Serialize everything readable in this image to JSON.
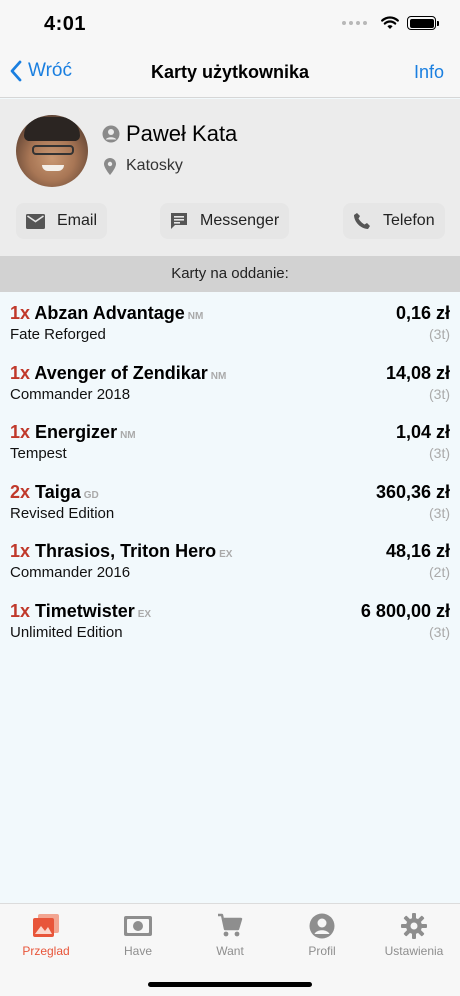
{
  "status": {
    "time": "4:01"
  },
  "nav": {
    "back_label": "Wróć",
    "title": "Karty użytkownika",
    "info_label": "Info"
  },
  "profile": {
    "name": "Paweł Kata",
    "location": "Katosky"
  },
  "contacts": {
    "email": "Email",
    "messenger": "Messenger",
    "phone": "Telefon"
  },
  "section": {
    "title": "Karty na oddanie:"
  },
  "cards": [
    {
      "qty": "1x",
      "name": "Abzan Advantage",
      "condition": "NM",
      "set": "Fate Reforged",
      "price": "0,16 zł",
      "count": "(3t)"
    },
    {
      "qty": "1x",
      "name": "Avenger of Zendikar",
      "condition": "NM",
      "set": "Commander 2018",
      "price": "14,08 zł",
      "count": "(3t)"
    },
    {
      "qty": "1x",
      "name": "Energizer",
      "condition": "NM",
      "set": "Tempest",
      "price": "1,04 zł",
      "count": "(3t)"
    },
    {
      "qty": "2x",
      "name": "Taiga",
      "condition": "GD",
      "set": "Revised Edition",
      "price": "360,36 zł",
      "count": "(3t)"
    },
    {
      "qty": "1x",
      "name": "Thrasios, Triton Hero",
      "condition": "EX",
      "set": "Commander 2016",
      "price": "48,16 zł",
      "count": "(2t)"
    },
    {
      "qty": "1x",
      "name": "Timetwister",
      "condition": "EX",
      "set": "Unlimited Edition",
      "price": "6 800,00 zł",
      "count": "(3t)"
    }
  ],
  "tabs": [
    {
      "label": "Przeglad",
      "icon": "photos-icon",
      "active": true
    },
    {
      "label": "Have",
      "icon": "money-icon",
      "active": false
    },
    {
      "label": "Want",
      "icon": "cart-icon",
      "active": false
    },
    {
      "label": "Profil",
      "icon": "person-icon",
      "active": false
    },
    {
      "label": "Ustawienia",
      "icon": "gear-icon",
      "active": false
    }
  ],
  "colors": {
    "accent": "#1a7fe0",
    "quantity": "#c0392b",
    "active_tab": "#e8553a"
  }
}
